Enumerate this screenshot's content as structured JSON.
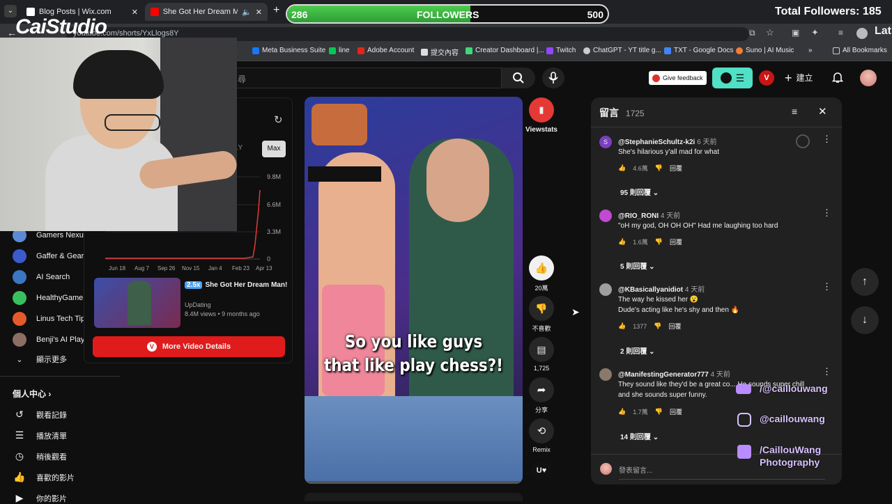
{
  "browser": {
    "tabs": [
      {
        "title": "Blog Posts | Wix.com"
      },
      {
        "title": "She Got Her Dream Man! -"
      }
    ],
    "url": "youtube.com/shorts/YxLlogs8Y",
    "bookmarks": [
      "Meta Business Suite",
      "line",
      "Adobe Account",
      "提交內容",
      "Creator Dashboard |...",
      "Twitch",
      "ChatGPT - YT title g...",
      "TXT - Google Docs",
      "Suno | AI Music",
      "All Bookmarks"
    ]
  },
  "overlay": {
    "followers_label": "FOLLOWERS",
    "followers_current": "286",
    "followers_goal": "500",
    "followers_progress": 0.572,
    "total_followers": "Total Followers: 185",
    "corner_text": "Lat",
    "studio_logo": "CaiStudio",
    "socials": [
      {
        "icon": "youtube-icon",
        "text": "/@caillouwang"
      },
      {
        "icon": "instagram-icon",
        "text": "@caillouwang"
      },
      {
        "icon": "facebook-icon",
        "text": "/CaillouWang\nPhotography"
      }
    ]
  },
  "youtube": {
    "search_placeholder": "尋",
    "feedback": "Give feedback",
    "create": "建立",
    "sidebar": {
      "subs": [
        {
          "name": "Gamers Nexus",
          "color": "#5b8ad6"
        },
        {
          "name": "Gaffer & Gear",
          "color": "#3b5bcc"
        },
        {
          "name": "AI Search",
          "color": "#3a76c4"
        },
        {
          "name": "HealthyGamerGG",
          "color": "#38c05e"
        },
        {
          "name": "Linus Tech Tips",
          "color": "#e55a2b"
        },
        {
          "name": "Benji's AI Playgro...",
          "color": "#8d6e63"
        }
      ],
      "show_more": "顯示更多",
      "you_heading": "個人中心",
      "you_items": [
        "觀看記錄",
        "播放清單",
        "稍後觀看",
        "喜歡的影片",
        "你的影片"
      ]
    },
    "stats": {
      "range_1y": "1Y",
      "range_max": "Max",
      "y_ticks": [
        "9.8M",
        "6.6M",
        "3.3M",
        "0"
      ],
      "x_ticks": [
        "Jun 18",
        "Aug 7",
        "Sep 26",
        "Nov 15",
        "Jan 4",
        "Feb 23",
        "Apr 13"
      ],
      "badge": "2.5x",
      "video_title": "She Got Her Dream Man!",
      "channel": "UpDating",
      "meta": "8.4M views • 9 months ago",
      "details_button": "More Video Details"
    },
    "video": {
      "caption_line1": "So you like guys",
      "caption_line2": "that like play chess?!"
    },
    "actions": {
      "viewstats": "Viewstats",
      "likes": "20萬",
      "dislike": "不喜歡",
      "comments": "1,725",
      "share": "分享",
      "remix": "Remix"
    },
    "comments_panel": {
      "title": "留言",
      "count": "1725",
      "add_placeholder": "發表留言...",
      "reply_label": "回覆",
      "items": [
        {
          "handle": "@StephanieSchultz-k2i",
          "time": "6 天前",
          "text": "She's hilarious y'all mad for what",
          "likes": "4.6萬",
          "replies": "95 則回覆",
          "avatar": "#7b3fbf"
        },
        {
          "handle": "@RIO_RONI",
          "time": "4 天前",
          "text": "\"oH my god, OH OH OH\" Had me laughing too hard",
          "likes": "1.6萬",
          "replies": "5 則回覆",
          "avatar": "#c04ad0"
        },
        {
          "handle": "@KBasicallyanidiot",
          "time": "4 天前",
          "text": "The way he kissed her 😮\nDude's acting like he's shy and then 🔥",
          "likes": "1377",
          "replies": "2 則回覆",
          "avatar": "#9e9e9e"
        },
        {
          "handle": "@ManifestingGenerator777",
          "time": "4 天前",
          "text": "They sound like they'd be a great co... He sounds super chill\nand she sounds super funny.",
          "likes": "1.7萬",
          "replies": "14 則回覆",
          "avatar": "#8a7a6a"
        }
      ]
    }
  }
}
